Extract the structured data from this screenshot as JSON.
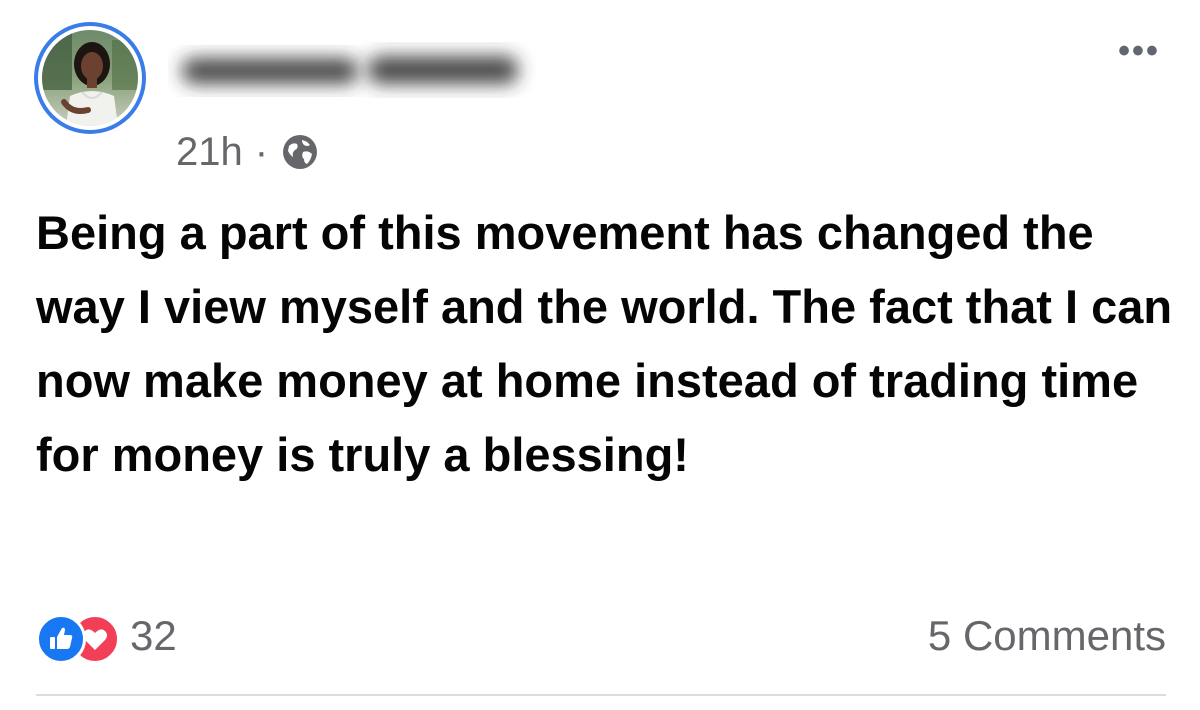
{
  "post": {
    "author": {
      "avatar_icon": "profile-photo",
      "ring_color": "#3b7de8",
      "name_obscured": true
    },
    "timestamp": "21h",
    "separator": "·",
    "privacy_icon": "globe-icon",
    "more_icon": "ellipsis-icon",
    "more_label": "•••",
    "text": "Being a part of this movement has changed the way I view myself and the world. The fact that I can now make money at home instead of trading time for money is truly a blessing!",
    "reactions": {
      "icons": [
        "like-icon",
        "love-icon"
      ],
      "like_color": "#1877f2",
      "love_color": "#f33e58",
      "count": "32"
    },
    "comments_label": "5 Comments"
  }
}
